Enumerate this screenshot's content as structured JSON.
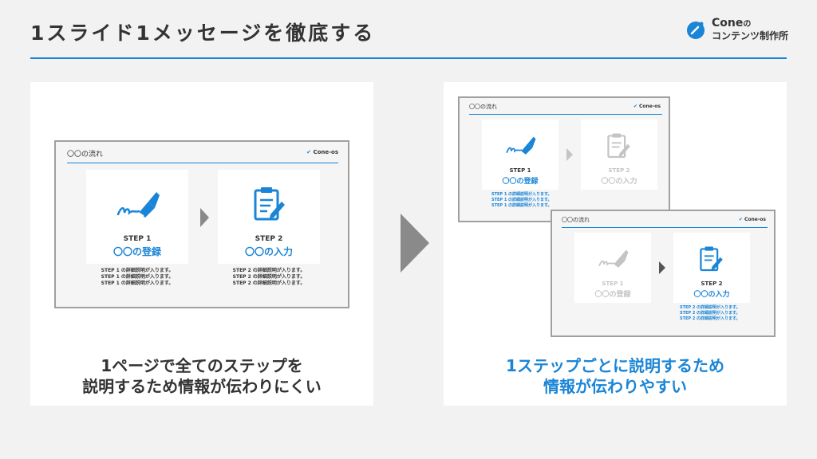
{
  "title": "1スライド1メッセージを徹底する",
  "logo": {
    "line1": "Cone",
    "line1_suffix": "の",
    "line2": "コンテンツ制作所"
  },
  "colors": {
    "accent": "#1a85d6",
    "gray": "#8a8a8a",
    "dim": "#c4c4c4"
  },
  "slide": {
    "heading": "〇〇の流れ",
    "logo_text": "Cone-os"
  },
  "steps": [
    {
      "step": "STEP 1",
      "name": "〇〇の登録",
      "icon": "pen-signature-icon",
      "desc": [
        "STEP 1 の詳細説明が入ります。",
        "STEP 1 の詳細説明が入ります。",
        "STEP 1 の詳細説明が入ります。"
      ]
    },
    {
      "step": "STEP 2",
      "name": "〇〇の入力",
      "icon": "clipboard-edit-icon",
      "desc": [
        "STEP 2 の詳細説明が入ります。",
        "STEP 2 の詳細説明が入ります。",
        "STEP 2 の詳細説明が入ります。"
      ]
    }
  ],
  "captions": {
    "left": [
      "1ページで全てのステップを",
      "説明するため情報が伝わりにくい"
    ],
    "right": [
      "1ステップごとに説明するため",
      "情報が伝わりやすい"
    ]
  }
}
